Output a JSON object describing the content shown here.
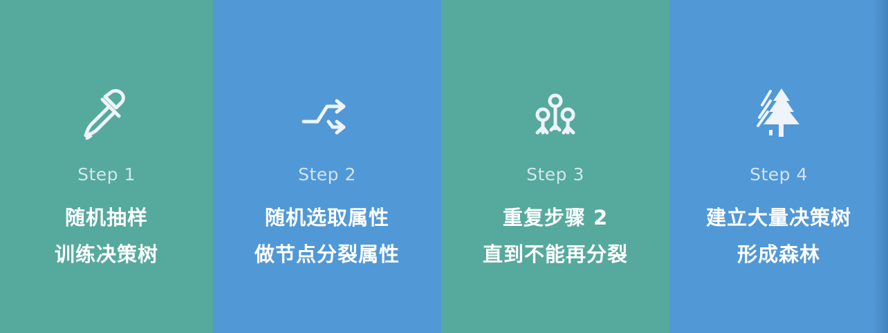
{
  "steps": [
    {
      "icon": "pipette-icon",
      "label": "Step 1",
      "line1": "随机抽样",
      "line2": "训练决策树",
      "color": "#56a99d"
    },
    {
      "icon": "shuffle-arrows-icon",
      "label": "Step 2",
      "line1": "随机选取属性",
      "line2": "做节点分裂属性",
      "color": "#5198d6"
    },
    {
      "icon": "node-split-icon",
      "label": "Step 3",
      "line1": "重复步骤 2",
      "line2": "直到不能再分裂",
      "color": "#56a99d"
    },
    {
      "icon": "pine-tree-icon",
      "label": "Step 4",
      "line1": "建立大量决策树",
      "line2": "形成森林",
      "color": "#5198d6"
    }
  ],
  "icon_color": "#eef4fa"
}
